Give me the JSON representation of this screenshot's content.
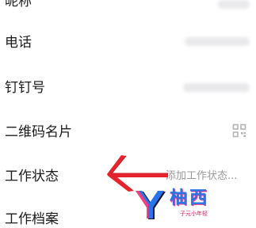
{
  "rows": [
    {
      "label": "昵称"
    },
    {
      "label": "电话"
    },
    {
      "label": "钉钉号"
    },
    {
      "label": "二维码名片",
      "icon": "qr-code-icon"
    },
    {
      "label": "工作状态",
      "value": "添加工作状态..."
    },
    {
      "label": "工作档案"
    }
  ],
  "watermark": {
    "text": "柚西",
    "subtext": "子元小年轻",
    "colors": {
      "blue": "#2a73e8",
      "pink": "#ff3b7a"
    }
  },
  "annotation": {
    "icon": "red-arrow-icon",
    "color": "#e5242b"
  }
}
